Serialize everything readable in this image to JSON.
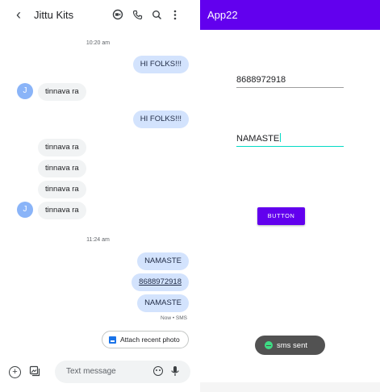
{
  "messages_app": {
    "contact_name": "Jittu Kits",
    "icons": {
      "back": "chevron-left-icon",
      "video": "video-call-icon",
      "phone": "phone-icon",
      "search": "search-icon",
      "menu": "more-vertical-icon"
    },
    "timestamps": [
      "10:20 am",
      "11:24 am"
    ],
    "avatar_initial": "J",
    "messages": [
      {
        "direction": "out",
        "text": "HI FOLKS!!!"
      },
      {
        "direction": "in",
        "text": "tinnava ra"
      },
      {
        "direction": "out",
        "text": "HI FOLKS!!!"
      },
      {
        "direction": "in",
        "text": "tinnava ra"
      },
      {
        "direction": "in",
        "text": "tinnava ra"
      },
      {
        "direction": "in",
        "text": "tinnava ra"
      },
      {
        "direction": "in",
        "text": "tinnava ra"
      },
      {
        "direction": "out",
        "text": "NAMASTE"
      },
      {
        "direction": "out",
        "text": "8688972918"
      },
      {
        "direction": "out",
        "text": "NAMASTE"
      }
    ],
    "last_status": "Now • SMS",
    "attach_chip_label": "Attach recent photo",
    "composer": {
      "placeholder": "Text message"
    }
  },
  "app22": {
    "title": "App22",
    "phone_field_value": "8688972918",
    "message_field_value": "NAMASTE",
    "button_label": "BUTTON",
    "toast_text": "sms sent",
    "colors": {
      "primary": "#6200ee",
      "accent": "#03dac5",
      "toast": "#525252"
    }
  }
}
